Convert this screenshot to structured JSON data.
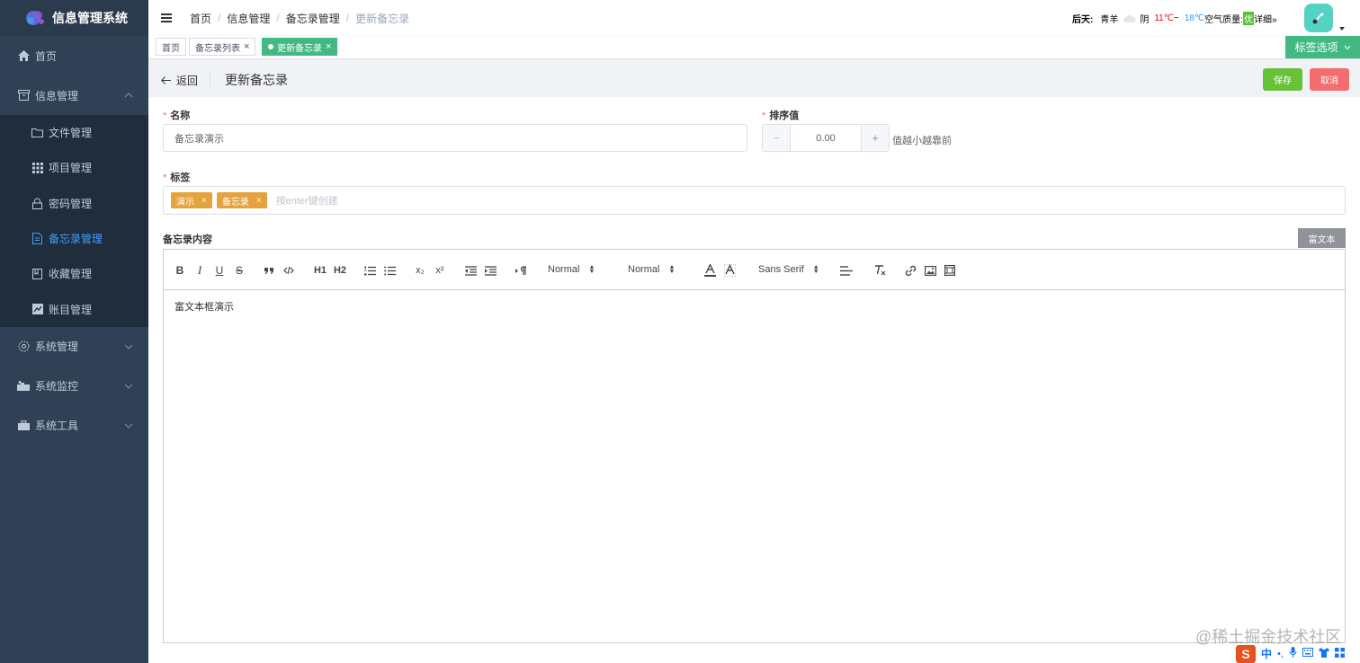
{
  "app": {
    "title": "信息管理系统"
  },
  "sidebar": {
    "items": [
      {
        "label": "首页",
        "icon": "home-icon"
      },
      {
        "label": "信息管理",
        "icon": "archive-icon"
      },
      {
        "label": "系统管理",
        "icon": "gear-icon"
      },
      {
        "label": "系统监控",
        "icon": "monitor-icon"
      },
      {
        "label": "系统工具",
        "icon": "toolbox-icon"
      }
    ],
    "sub_items": [
      {
        "label": "文件管理",
        "icon": "folder-icon"
      },
      {
        "label": "项目管理",
        "icon": "grid-icon"
      },
      {
        "label": "密码管理",
        "icon": "lock-icon"
      },
      {
        "label": "备忘录管理",
        "icon": "document-icon",
        "active": true
      },
      {
        "label": "收藏管理",
        "icon": "bookmark-icon"
      },
      {
        "label": "账目管理",
        "icon": "ledger-icon"
      }
    ]
  },
  "breadcrumb": [
    "首页",
    "信息管理",
    "备忘录管理",
    "更新备忘录"
  ],
  "breadcrumb_sep": "/",
  "weather": {
    "day": "后天:",
    "city": "青羊",
    "condition": "阴",
    "high": "11℃",
    "tilde": "~",
    "low": "18℃",
    "aq_label": "空气质量:",
    "aq_value": "优",
    "detail": "详细»"
  },
  "tags": {
    "items": [
      "首页",
      "备忘录列表",
      "更新备忘录"
    ],
    "close": "×",
    "options_label": "标签选项"
  },
  "page": {
    "back_label": "返回",
    "title": "更新备忘录",
    "save_label": "保存",
    "cancel_label": "取消"
  },
  "form": {
    "required_mark": "*",
    "name_label": "名称",
    "name_value": "备忘录演示",
    "sort_label": "排序值",
    "sort_value": "0.00",
    "sort_minus": "−",
    "sort_plus": "+",
    "sort_hint": "值越小越靠前",
    "tags_label": "标签",
    "tags": [
      "演示",
      "备忘录"
    ],
    "tag_close": "×",
    "tags_placeholder": "按enter键创建",
    "content_label": "备忘录内容",
    "richtext_label": "富文本"
  },
  "editor": {
    "toolbar": {
      "bold": "B",
      "italic": "I",
      "underline": "U",
      "strike": "S",
      "header1": "H1",
      "header2": "H2",
      "sub": "x₂",
      "sup": "x²",
      "size_value": "Normal",
      "header_value": "Normal",
      "font_value": "Sans Serif"
    },
    "content": "富文本框演示"
  },
  "watermark": "@稀土掘金技术社区",
  "ime": {
    "logo": "S",
    "mode": "中"
  }
}
